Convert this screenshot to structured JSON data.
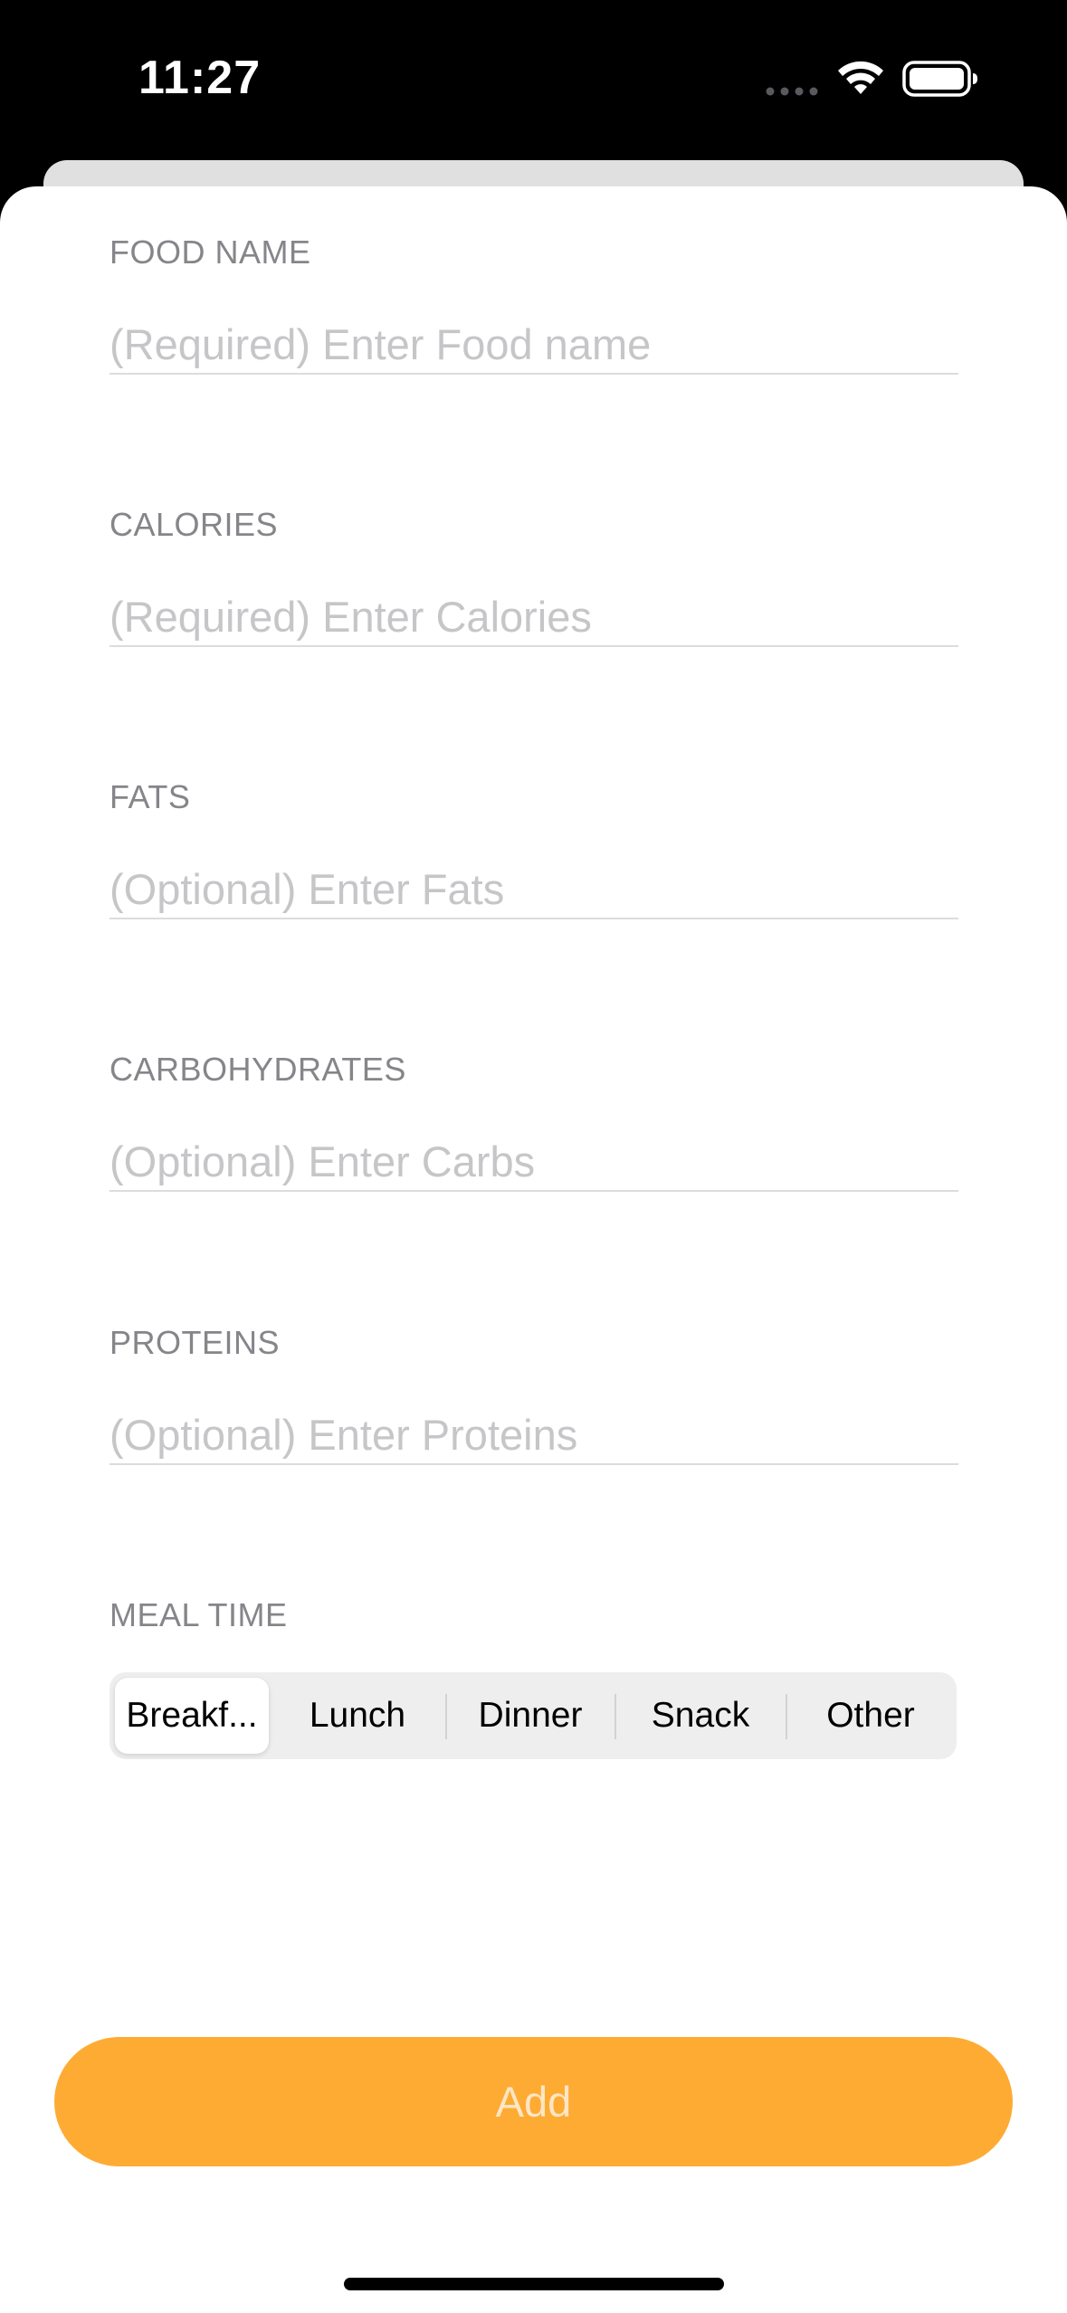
{
  "status_bar": {
    "time": "11:27",
    "icons": [
      "cellular-dots-icon",
      "wifi-icon",
      "battery-icon"
    ]
  },
  "form": {
    "fields": [
      {
        "label": "FOOD NAME",
        "placeholder": "(Required) Enter Food name",
        "value": ""
      },
      {
        "label": "CALORIES",
        "placeholder": "(Required) Enter Calories",
        "value": ""
      },
      {
        "label": "FATS",
        "placeholder": "(Optional) Enter Fats",
        "value": ""
      },
      {
        "label": "CARBOHYDRATES",
        "placeholder": "(Optional) Enter Carbs",
        "value": ""
      },
      {
        "label": "PROTEINS",
        "placeholder": "(Optional) Enter Proteins",
        "value": ""
      }
    ],
    "meal_time": {
      "label": "MEAL TIME",
      "options": [
        "Breakf...",
        "Lunch",
        "Dinner",
        "Snack",
        "Other"
      ],
      "selected": "Breakf..."
    }
  },
  "add_button": {
    "label": "Add"
  },
  "colors": {
    "accent": "#feab34",
    "label_gray": "#85858a",
    "placeholder_gray": "#c6c6c9"
  }
}
